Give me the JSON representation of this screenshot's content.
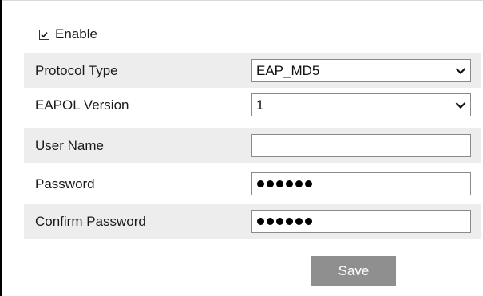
{
  "enable": {
    "label": "Enable",
    "checked": true
  },
  "form": {
    "protocol_type": {
      "label": "Protocol Type",
      "value": "EAP_MD5"
    },
    "eapol_version": {
      "label": "EAPOL Version",
      "value": "1"
    },
    "user_name": {
      "label": "User Name",
      "value": ""
    },
    "password": {
      "label": "Password",
      "masked_length": 6
    },
    "confirm_password": {
      "label": "Confirm Password",
      "masked_length": 6
    }
  },
  "actions": {
    "save_label": "Save"
  },
  "colors": {
    "alt_row_background": "#ededed",
    "button_background": "#8f8f8f",
    "button_text": "#ffffff"
  },
  "icons": {
    "checkbox": "checkmark-icon",
    "dropdown": "chevron-down-icon",
    "password_mask": "bullet-dot"
  }
}
